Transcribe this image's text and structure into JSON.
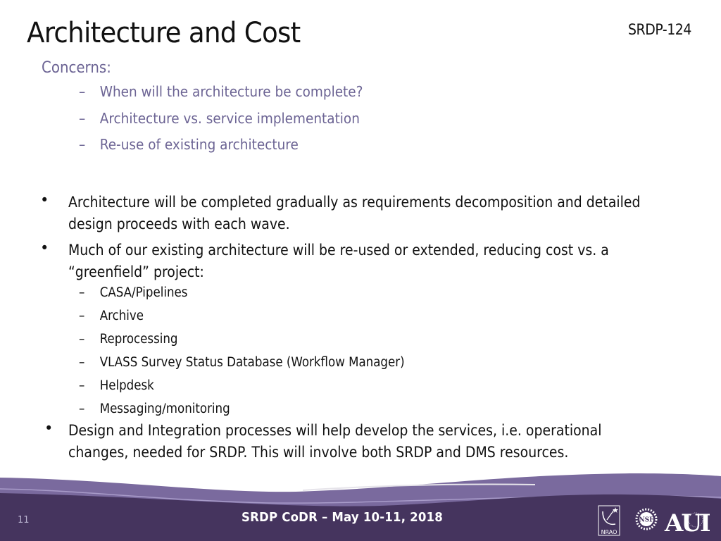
{
  "slide": {
    "title": "Architecture and Cost",
    "doc_id": "SRDP-124",
    "concerns": {
      "heading": "Concerns:",
      "items": [
        "When will the architecture be complete?",
        "Architecture vs. service implementation",
        "Re-use of existing architecture"
      ]
    },
    "bullets": [
      {
        "lines": [
          "Architecture will be completed gradually as requirements decomposition and detailed",
          "design proceeds with each wave."
        ]
      },
      {
        "lines": [
          "Much of our existing architecture will be re-used or extended, reducing cost vs. a",
          "“greenfield” project:"
        ],
        "sub_items": [
          "CASA/Pipelines",
          "Archive",
          "Reprocessing",
          "VLASS Survey Status Database (Workflow Manager)",
          "Helpdesk",
          "Messaging/monitoring"
        ]
      },
      {
        "lines": [
          "Design and Integration processes will help develop the services, i.e. operational",
          "changes, needed for SRDP.  This will involve both SRDP and DMS resources."
        ]
      }
    ],
    "bullet_glyph": "•",
    "dash_glyph": "–"
  },
  "footer": {
    "event": "SRDP CoDR – May 10-11, 2018",
    "slide_number": "11",
    "logos": [
      {
        "name": "nrao-logo",
        "label": "NRAO"
      },
      {
        "name": "nsf-logo",
        "label": "NSF"
      },
      {
        "name": "aui-logo",
        "label": "AUI"
      }
    ],
    "colors": {
      "dark": "#45345e",
      "mid": "#7a6a9e",
      "light": "#9a8cbc"
    }
  },
  "colors": {
    "concern_text": "#6c6494",
    "body_text": "#111111"
  }
}
